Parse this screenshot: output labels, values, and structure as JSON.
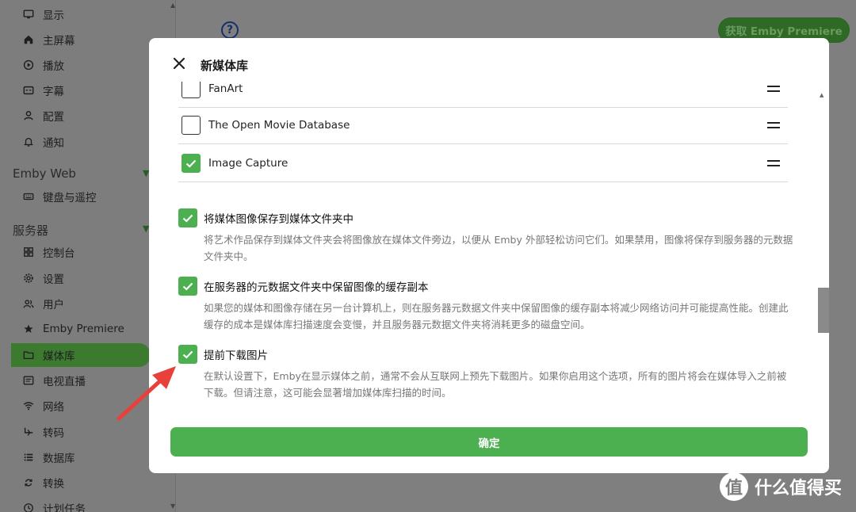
{
  "sidebar": {
    "items_top": [
      {
        "label": "显示",
        "icon": "monitor-icon"
      },
      {
        "label": "主屏幕",
        "icon": "home-icon"
      },
      {
        "label": "播放",
        "icon": "play-circle-icon"
      },
      {
        "label": "字幕",
        "icon": "subtitles-icon"
      },
      {
        "label": "配置",
        "icon": "person-icon"
      },
      {
        "label": "通知",
        "icon": "bell-icon"
      }
    ],
    "section_emby_web": "Emby Web",
    "items_web": [
      {
        "label": "键盘与遥控",
        "icon": "keyboard-icon"
      }
    ],
    "section_server": "服务器",
    "items_server": [
      {
        "label": "控制台",
        "icon": "dashboard-icon"
      },
      {
        "label": "设置",
        "icon": "gear-icon"
      },
      {
        "label": "用户",
        "icon": "users-icon"
      },
      {
        "label": "Emby Premiere",
        "icon": "star-icon"
      },
      {
        "label": "媒体库",
        "icon": "folder-icon"
      },
      {
        "label": "电视直播",
        "icon": "tv-guide-icon"
      },
      {
        "label": "网络",
        "icon": "wifi-icon"
      },
      {
        "label": "转码",
        "icon": "transcode-icon"
      },
      {
        "label": "数据库",
        "icon": "database-icon"
      },
      {
        "label": "转换",
        "icon": "convert-icon"
      },
      {
        "label": "计划任务",
        "icon": "clock-icon"
      }
    ]
  },
  "header": {
    "help_label": "?",
    "premiere_button": "获取 Emby Premiere"
  },
  "dialog": {
    "title": "新媒体库",
    "fetchers": [
      {
        "label": "FanArt",
        "checked": false
      },
      {
        "label": "The Open Movie Database",
        "checked": false
      },
      {
        "label": "Image Capture",
        "checked": true
      }
    ],
    "options": [
      {
        "title": "将媒体图像保存到媒体文件夹中",
        "desc": "将艺术作品保存到媒体文件夹会将图像放在媒体文件旁边，以便从 Emby 外部轻松访问它们。如果禁用，图像将保存到服务器的元数据文件夹中。",
        "checked": true
      },
      {
        "title": "在服务器的元数据文件夹中保留图像的缓存副本",
        "desc": "如果您的媒体和图像存储在另一台计算机上，则在服务器元数据文件夹中保留图像的缓存副本将减少网络访问并可能提高性能。创建此缓存的成本是媒体库扫描速度会变慢，并且服务器元数据文件夹将消耗更多的磁盘空间。",
        "checked": true
      },
      {
        "title": "提前下载图片",
        "desc": "在默认设置下，Emby在显示媒体之前，通常不会从互联网上预先下载图片。如果你启用这个选项，所有的图片将会在媒体导入之前被下载。但请注意，这可能会显著增加媒体库扫描的时间。",
        "checked": true
      }
    ],
    "ok_button": "确定"
  },
  "watermark": {
    "logo_char": "值",
    "text": "什么值得买"
  },
  "colors": {
    "accent": "#4caf50",
    "overlay": "#7f7f7f",
    "annotation_arrow": "#e8413c"
  }
}
